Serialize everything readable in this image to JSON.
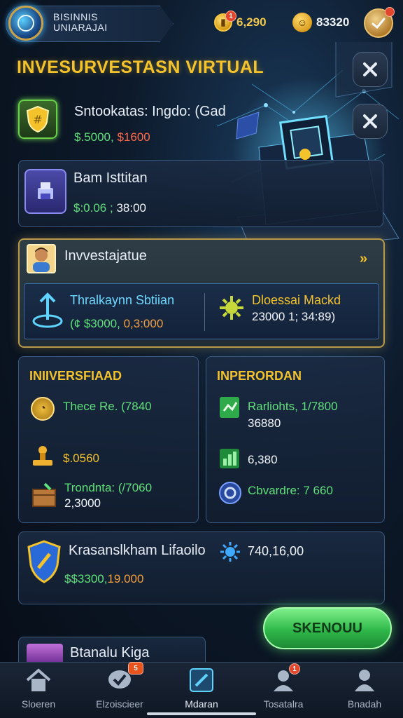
{
  "header": {
    "brand_line1": "BISINNIS",
    "brand_line2": "UNIARAJAI",
    "currency1": {
      "icon": "gold-coin-icon",
      "value": "6,290",
      "badge": "1"
    },
    "currency2": {
      "icon": "smile-coin-icon",
      "value": "83320"
    }
  },
  "headline": "INVESURVESTASN VIRTUAL",
  "investments": [
    {
      "title": "Sntookatas: Ingdo: (Gad",
      "value_green": "$.5000,",
      "value_red": "$1600",
      "icon": "shield-icon"
    },
    {
      "title": "Bam Isttitan",
      "value_green": "$:0.06 ;",
      "value_white": "38:00",
      "icon": "printer-icon"
    }
  ],
  "featured": {
    "title": "Invvestajatue",
    "left": {
      "title": "Thralkaynn Sbtiian",
      "value_green": "(¢ $3000,",
      "value_orange": "0,3:000",
      "icon": "anchor-icon"
    },
    "right": {
      "title": "Dloessai Mackd",
      "value": "23000 1; 34:89)",
      "icon": "gear-icon"
    }
  },
  "panels": [
    {
      "title": "INIIVERSFIAAD",
      "rows": [
        {
          "icon": "clock-coin-icon",
          "text": "Thece Re. (7840",
          "color": "green"
        },
        {
          "icon": "stamp-icon",
          "text": "$.0560",
          "color": "yellow"
        },
        {
          "icon": "crate-icon",
          "text": "Trondnta: (/7060",
          "sub": "2,3000",
          "color": "green"
        }
      ]
    },
    {
      "title": "INPERORDAN",
      "rows": [
        {
          "icon": "document-icon",
          "text": "Rarliohts, 1/7800",
          "sub": "36880",
          "color": "green"
        },
        {
          "icon": "chart-icon",
          "text": "6,380",
          "color": "white"
        },
        {
          "icon": "vault-icon",
          "text": "Cbvardre: 7 660",
          "color": "green"
        }
      ]
    }
  ],
  "bottom_card": {
    "title": "Krasanslkham Lifaoilo",
    "value_green": "$$3300,",
    "value_orange": "19.000",
    "right_value": "740,16,00",
    "icon": "badge-shield-icon",
    "right_icon": "sun-gear-icon"
  },
  "partial_card": {
    "title": "Btanalu Kiga",
    "icon": "folder-icon"
  },
  "primary_button": "SKENOUU",
  "nav": [
    {
      "label": "Sloeren",
      "icon": "home-icon",
      "badge": ""
    },
    {
      "label": "Elzoiscieer",
      "icon": "chat-check-icon",
      "badge": "5"
    },
    {
      "label": "Mdaran",
      "icon": "edit-icon",
      "badge": ""
    },
    {
      "label": "Tosatalra",
      "icon": "users-icon",
      "badge": "1"
    },
    {
      "label": "Bnadah",
      "icon": "user-icon",
      "badge": ""
    }
  ],
  "colors": {
    "accent_gold": "#f4c22b",
    "accent_green": "#5ee07a",
    "accent_red": "#ff6a4a",
    "panel_border": "#3a5a80"
  }
}
